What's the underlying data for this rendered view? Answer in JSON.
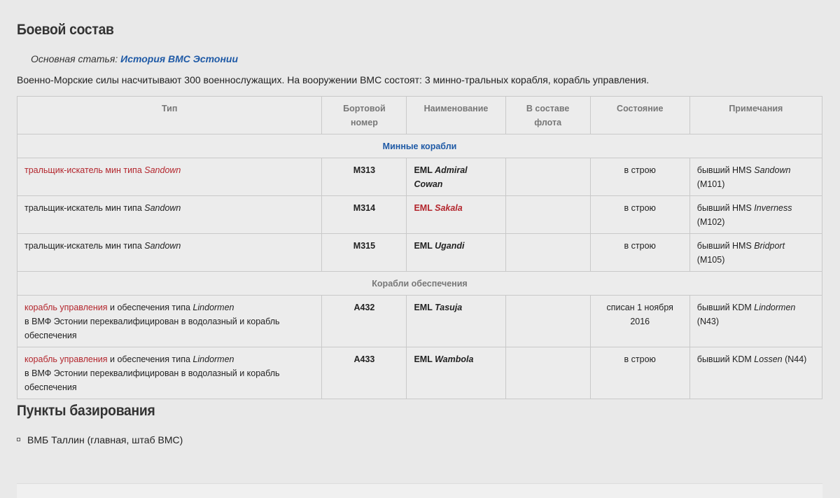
{
  "section1": {
    "title": "Боевой состав",
    "main_article_prefix": "Основная статья: ",
    "main_article_link": "История ВМС Эстонии",
    "intro": "Военно-Морские силы насчитывают 300 военнослужащих. На вооружении ВМС состоят: 3 минно-тральных корабля, корабль управления."
  },
  "table": {
    "headers": [
      "Тип",
      "Бортовой номер",
      "Наименование",
      "В составе флота",
      "Состояние",
      "Примечания"
    ],
    "groups": [
      {
        "label": "Минные корабли"
      },
      {
        "label": "Корабли обеспечения"
      }
    ],
    "rows": [
      {
        "type_pre": "тральщик-искатель мин типа ",
        "type_it": "Sandown",
        "type_rest": "",
        "type_extra": "",
        "number": "M313",
        "name_pre": "EML ",
        "name_it": "Admiral Cowan",
        "fleet": "",
        "state": "в строю",
        "note_pre": "бывший HMS ",
        "note_it": "Sandown",
        "note_post": " (M101)"
      },
      {
        "type_pre": "тральщик-искатель мин типа ",
        "type_it": "Sandown",
        "type_rest": "",
        "type_extra": "",
        "number": "M314",
        "name_pre": "EML ",
        "name_it": "Sakala",
        "fleet": "",
        "state": "в строю",
        "note_pre": "бывший HMS ",
        "note_it": "Inverness",
        "note_post": " (M102)"
      },
      {
        "type_pre": "тральщик-искатель мин типа ",
        "type_it": "Sandown",
        "type_rest": "",
        "type_extra": "",
        "number": "M315",
        "name_pre": "EML ",
        "name_it": "Ugandi",
        "fleet": "",
        "state": "в строю",
        "note_pre": "бывший HMS ",
        "note_it": "Bridport",
        "note_post": " (M105)"
      },
      {
        "type_pre": "корабль управления",
        "type_mid": " и обеспечения типа ",
        "type_it": "Lindormen",
        "type_extra": "в ВМФ Эстонии переквалифицирован в водолазный и корабль обеспечения",
        "number": "A432",
        "name_pre": "EML ",
        "name_it": "Tasuja",
        "fleet": "",
        "state": "списан 1 ноября 2016",
        "note_pre": "бывший KDM ",
        "note_it": "Lindormen",
        "note_post": " (N43)"
      },
      {
        "type_pre": "корабль управления",
        "type_mid": " и обеспечения типа ",
        "type_it": "Lindormen",
        "type_extra": "в ВМФ Эстонии переквалифицирован в водолазный и корабль обеспечения",
        "number": "A433",
        "name_pre": "EML ",
        "name_it": "Wambola",
        "fleet": "",
        "state": "в строю",
        "note_pre": "бывший KDM ",
        "note_it": "Lossen",
        "note_post": " (N44)"
      }
    ]
  },
  "section2": {
    "title": "Пункты базирования",
    "items": [
      "ВМБ Таллин (главная, штаб ВМС)"
    ]
  },
  "colors": {
    "link_blue": "#1f5aa6",
    "link_red": "#b3262d",
    "header_gray": "#777777"
  }
}
